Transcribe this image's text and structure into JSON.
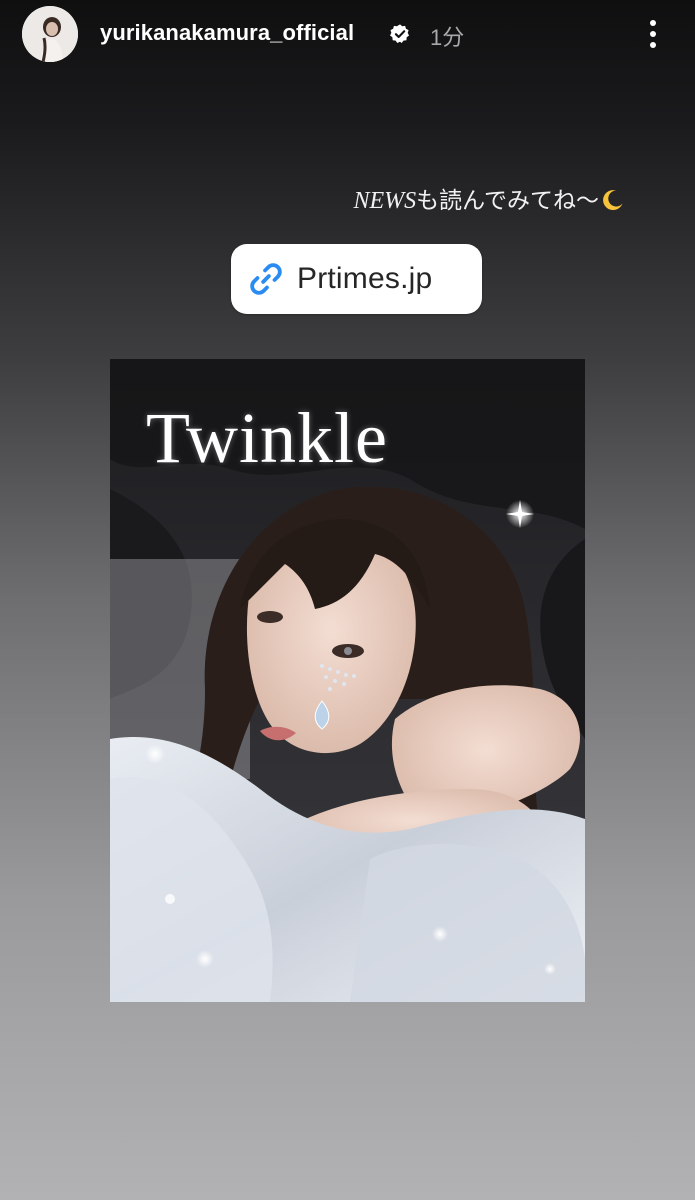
{
  "story": {
    "username": "yurikanakamura_official",
    "timestamp": "1分",
    "caption_news": "NEWS",
    "caption_text": "も読んでみてね〜",
    "link_label": "Prtimes.jp",
    "poster_title": "Twinkle"
  },
  "icons": {
    "verified": "verified-badge-icon",
    "more": "more-options-icon",
    "link": "link-icon",
    "moon": "crescent-moon-emoji"
  },
  "colors": {
    "link_blue": "#2a8cf0",
    "verified": "#ffffff",
    "timestamp": "#a9a9ab"
  }
}
